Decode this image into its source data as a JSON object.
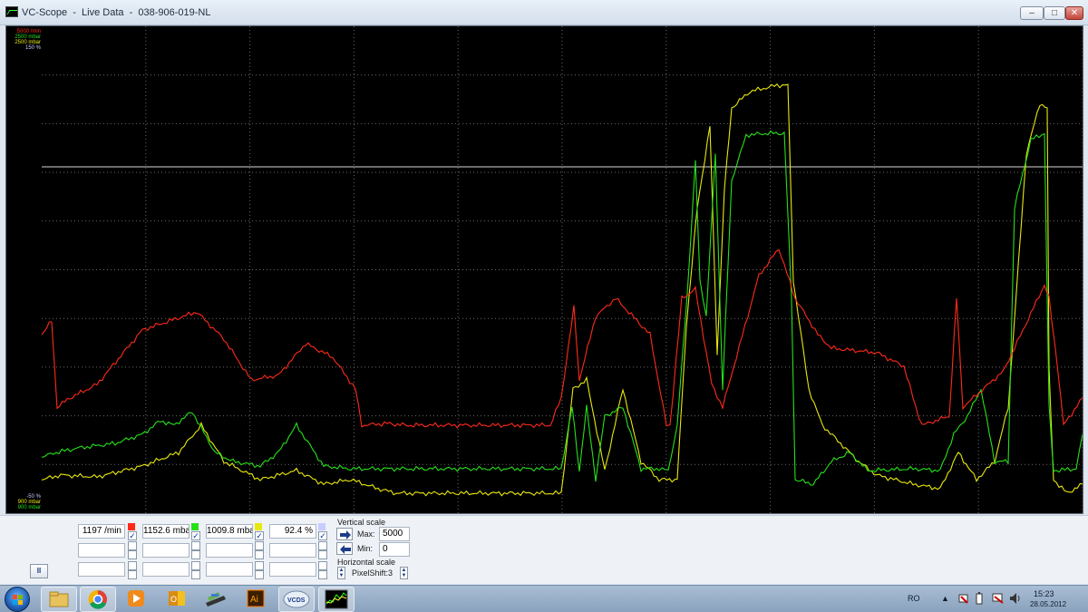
{
  "window": {
    "title": "VC-Scope  -  Live Data  -  038-906-019-NL",
    "min_label": "–",
    "max_label": "□",
    "close_label": "✕"
  },
  "scope": {
    "top_labels": [
      "5000 /min",
      "2500 mbar",
      "2500 mbar",
      "150 %"
    ],
    "bottom_labels": [
      "-50 %",
      "900 mbar",
      "900 mbar"
    ],
    "colors": {
      "rpm": "#ff2a1a",
      "mbar_a": "#26e01a",
      "mbar_b": "#e8e80e",
      "percent": "#c8ccff",
      "grid": "#6a6a6a",
      "marker": "#d8d8d8"
    }
  },
  "channels": [
    {
      "value": "1197 /min",
      "color": "#ff2a1a",
      "checked": true
    },
    {
      "value": "1152.6 mbar",
      "color": "#26e01a",
      "checked": true
    },
    {
      "value": "1009.8 mbar",
      "color": "#e8e80e",
      "checked": true
    },
    {
      "value": "92.4 %",
      "color": "#c8ccff",
      "checked": true
    }
  ],
  "vertical_scale": {
    "title": "Vertical scale",
    "max_label": "Max:",
    "max_value": "5000",
    "min_label": "Min:",
    "min_value": "0"
  },
  "horizontal_scale": {
    "title": "Horizontal scale",
    "pixelshift_label": "PixelShift:3"
  },
  "pause_label": "II",
  "taskbar": {
    "items": [
      "start-orb",
      "explorer-icon",
      "chrome-icon",
      "media-player-icon",
      "outlook-icon",
      "scanner-icon",
      "illustrator-icon",
      "vcds-icon",
      "vc-scope-icon"
    ],
    "illustrator_label": "Ai",
    "vcds_label": "VCDS",
    "lang": "RO",
    "time": "15:23",
    "date": "28.05.2012"
  }
}
